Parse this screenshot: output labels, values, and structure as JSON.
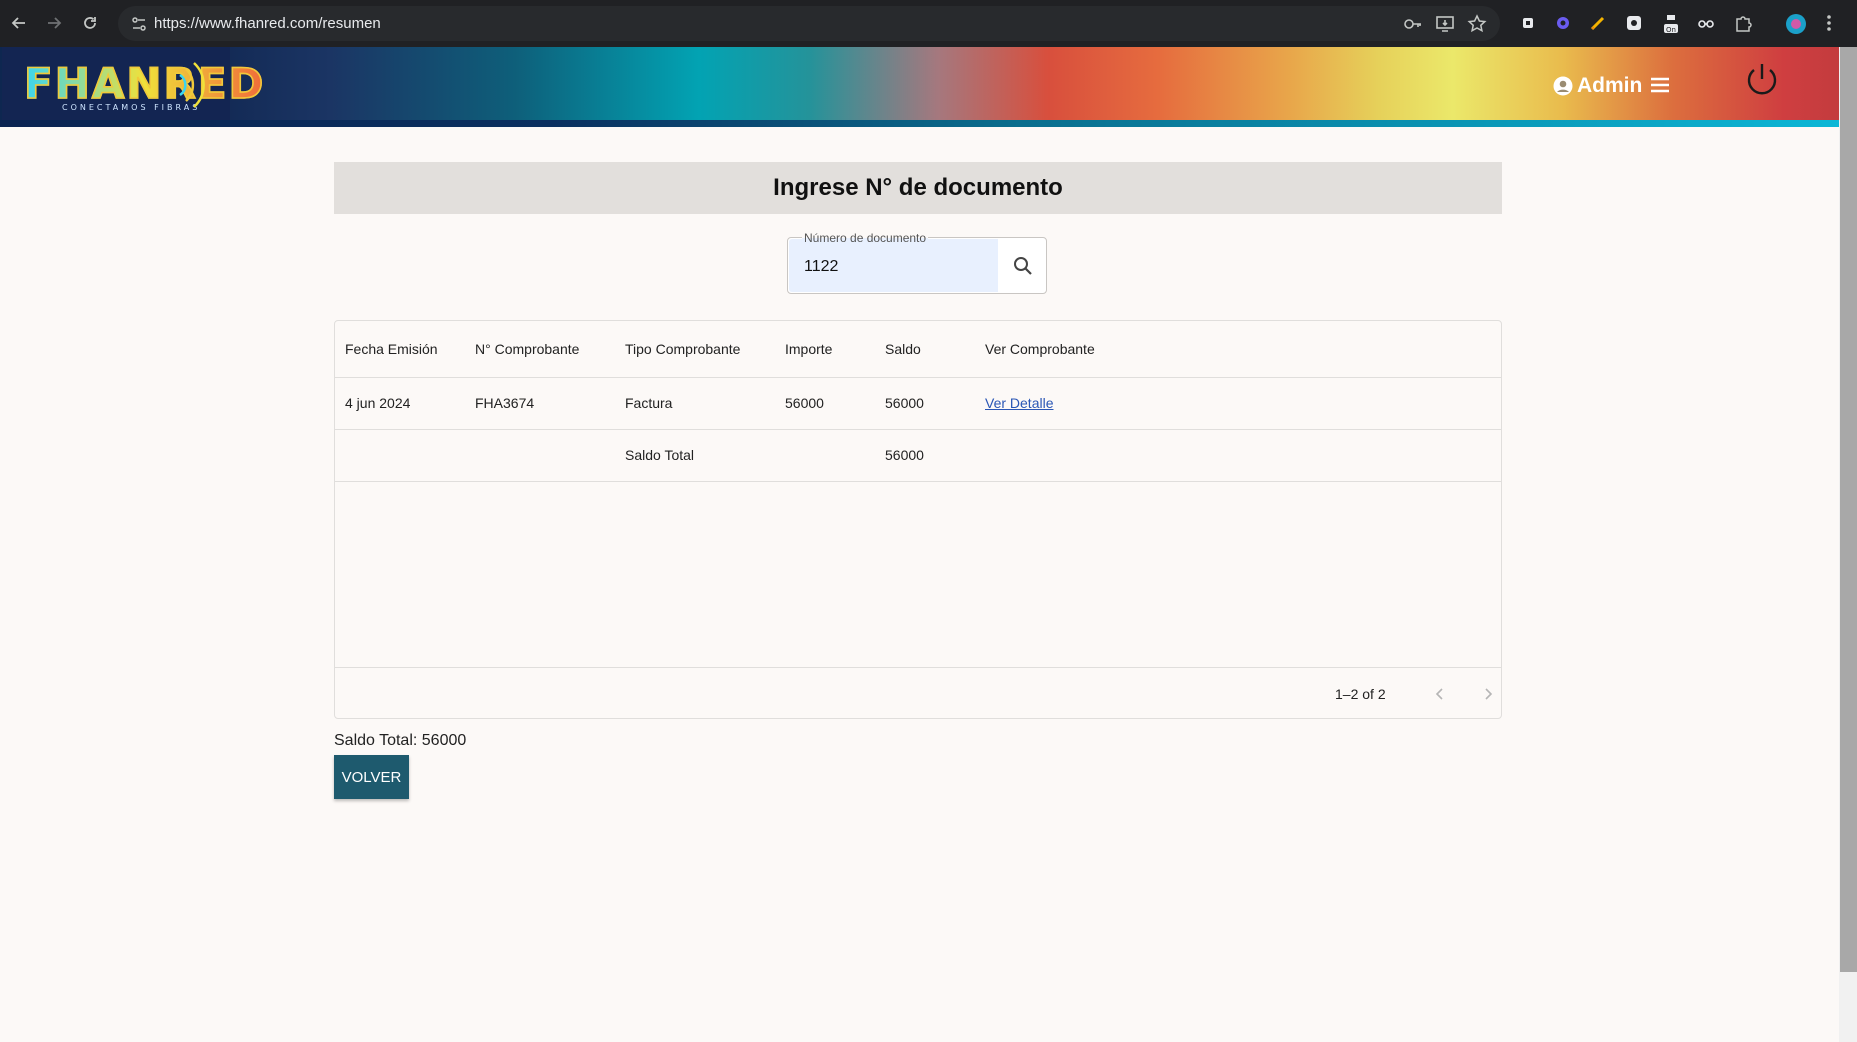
{
  "browser": {
    "url": "https://www.fhanred.com/resumen",
    "icons": [
      "back-arrow-icon",
      "forward-arrow-icon",
      "reload-icon",
      "site-info-icon",
      "password-key-icon",
      "install-app-icon",
      "bookmark-star-icon",
      "extensions-icon",
      "profile-avatar-icon",
      "more-menu-icon"
    ]
  },
  "header": {
    "logo_text": "FHANRED",
    "logo_subtitle": "CONECTAMOS FIBRAS",
    "user_label": "Admin",
    "icons": [
      "user-circle-icon",
      "hamburger-menu-icon",
      "power-icon"
    ],
    "colors": {
      "logo_bg": "#132552",
      "stripe": "#0cb7d6"
    }
  },
  "main": {
    "title": "Ingrese N° de documento",
    "search": {
      "label": "Número de documento",
      "value": "1122",
      "icon": "search-icon"
    },
    "table": {
      "columns": [
        "Fecha Emisión",
        "N° Comprobante",
        "Tipo Comprobante",
        "Importe",
        "Saldo",
        "Ver Comprobante"
      ],
      "rows": [
        {
          "fecha": "4 jun 2024",
          "comprobante": "FHA3674",
          "tipo": "Factura",
          "importe": "56000",
          "saldo": "56000",
          "ver": "Ver Detalle"
        }
      ],
      "total_row": {
        "label": "Saldo Total",
        "saldo": "56000"
      },
      "pagination": {
        "text": "1–2 of 2",
        "icons": [
          "chevron-left-icon",
          "chevron-right-icon"
        ]
      }
    },
    "summary": "Saldo Total: 56000",
    "back_button": "VOLVER",
    "colors": {
      "button_bg": "#1e5a6e",
      "link": "#2a56b5",
      "title_band": "#e2dfdc"
    }
  }
}
